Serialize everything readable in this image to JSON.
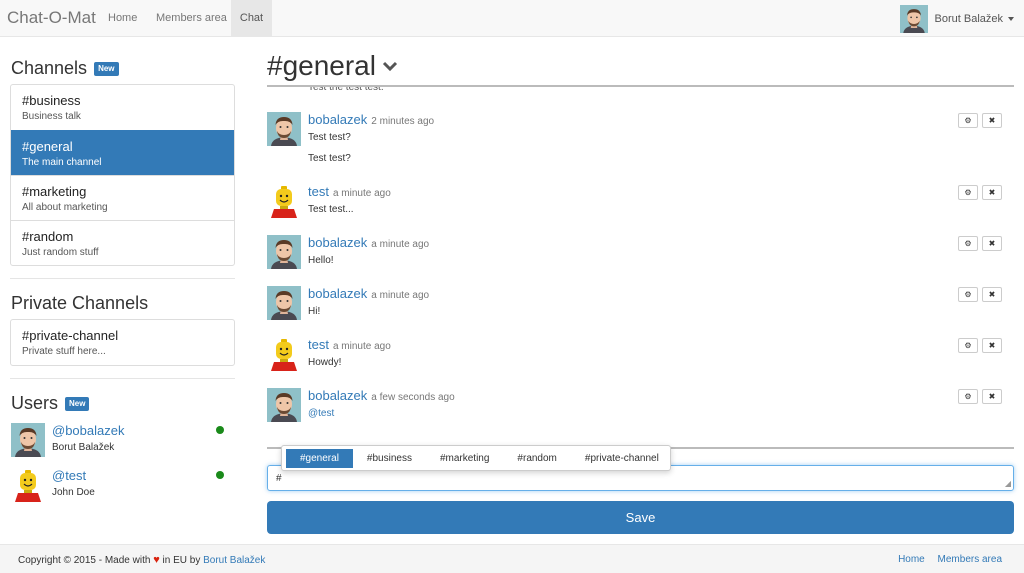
{
  "navbar": {
    "brand": "Chat-O-Mat",
    "links": [
      {
        "label": "Home"
      },
      {
        "label": "Members area"
      },
      {
        "label": "Chat"
      }
    ],
    "active": "Chat",
    "user_name": "Borut Balažek"
  },
  "sidebar": {
    "channels_title": "Channels",
    "channels_badge": "New",
    "channels": [
      {
        "name": "#business",
        "desc": "Business talk"
      },
      {
        "name": "#general",
        "desc": "The main channel"
      },
      {
        "name": "#marketing",
        "desc": "All about marketing"
      },
      {
        "name": "#random",
        "desc": "Just random stuff"
      }
    ],
    "active_channel": "#general",
    "private_title": "Private Channels",
    "private_channels": [
      {
        "name": "#private-channel",
        "desc": "Private stuff here..."
      }
    ],
    "users_title": "Users",
    "users_badge": "New",
    "users": [
      {
        "handle": "@bobalazek",
        "name": "Borut Balažek",
        "avatar": "face-avatar",
        "online": true
      },
      {
        "handle": "@test",
        "name": "John Doe",
        "avatar": "lego-avatar",
        "online": true
      }
    ]
  },
  "main": {
    "title": "#general",
    "peek_text": "Test the test test.",
    "messages": [
      {
        "author": "bobalazek",
        "time": "2 minutes ago",
        "avatar": "face-avatar",
        "lines": [
          "Test test?",
          "Test test?"
        ]
      },
      {
        "author": "test",
        "time": "a minute ago",
        "avatar": "lego-avatar",
        "lines": [
          "Test test..."
        ]
      },
      {
        "author": "bobalazek",
        "time": "a minute ago",
        "avatar": "face-avatar",
        "lines": [
          "Hello!"
        ]
      },
      {
        "author": "bobalazek",
        "time": "a minute ago",
        "avatar": "face-avatar",
        "lines": [
          "Hi!"
        ]
      },
      {
        "author": "test",
        "time": "a minute ago",
        "avatar": "lego-avatar",
        "lines": [
          "Howdy!"
        ]
      },
      {
        "author": "bobalazek",
        "time": "a few seconds ago",
        "avatar": "face-avatar",
        "lines": [
          "@test"
        ],
        "mention": true
      }
    ],
    "message_actions": {
      "edit_icon": "gear-icon",
      "delete_icon": "close-icon"
    },
    "autocomplete": [
      "#general",
      "#business",
      "#marketing",
      "#random",
      "#private-channel"
    ],
    "autocomplete_active": "#general",
    "input_value": "#",
    "save_label": "Save"
  },
  "footer": {
    "copyright": "Copyright © 2015 - Made with",
    "heart": "♥",
    "in_eu": "in EU by",
    "author": "Borut Balažek",
    "links": [
      "Home",
      "Members area"
    ]
  },
  "colors": {
    "primary": "#337ab7",
    "online": "#1a8a1a",
    "heart": "#d9230f"
  }
}
